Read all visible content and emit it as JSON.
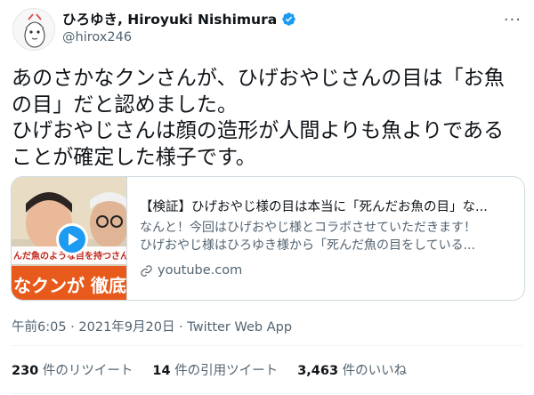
{
  "author": {
    "display_name": "ひろゆき, Hiroyuki Nishimura",
    "handle": "@hirox246"
  },
  "more_label": "···",
  "tweet_text": "あのさかなクンさんが、ひげおやじさんの目は「お魚の目」だと認めました。\nひげおやじさんは顔の造形が人間よりも魚よりであることが確定した様子です。",
  "card": {
    "thumb_text_top": "んだ魚のような目を持つさん",
    "thumb_text_bottom": "なクンが 徹底",
    "title": "【検証】ひげおやじ様の目は本当に「死んだお魚の目」な...",
    "description_line1": "なんと！今回はひげおやじ様とコラボさせていただきます！",
    "description_line2": "ひげおやじ様はひろゆき様から「死んだ魚の目をしている...",
    "domain": "youtube.com"
  },
  "meta": "午前6:05 · 2021年9月20日 · Twitter Web App",
  "stats": [
    {
      "count": "230",
      "label": "件のリツイート"
    },
    {
      "count": "14",
      "label": "件の引用ツイート"
    },
    {
      "count": "3,463",
      "label": "件のいいね"
    }
  ],
  "colors": {
    "verified": "#1d9bf0",
    "secondary_text": "#536471",
    "border": "#cfd9de"
  }
}
